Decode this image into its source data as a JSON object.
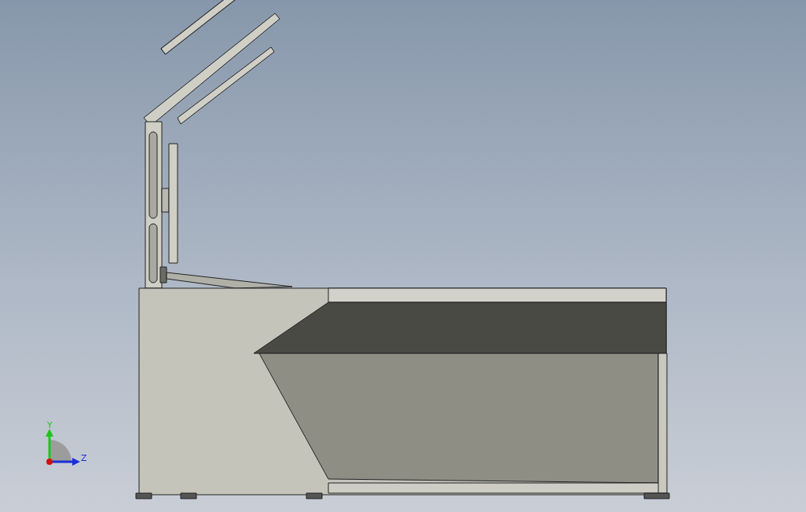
{
  "triad": {
    "y_label": "Y",
    "z_label": "Z"
  }
}
